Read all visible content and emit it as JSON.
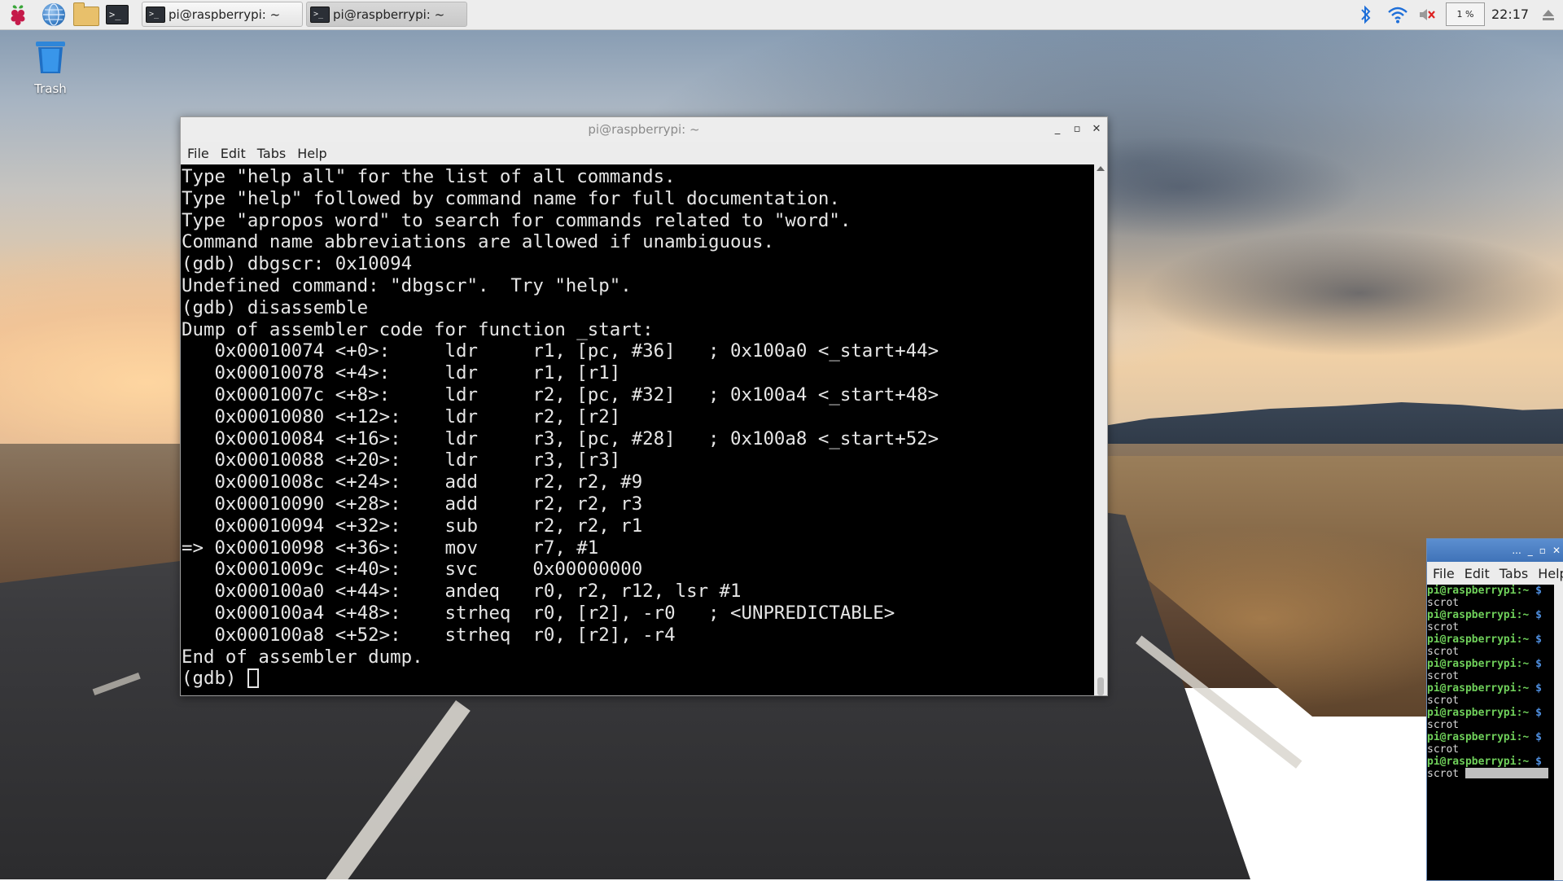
{
  "colors": {
    "panel_bg": "#ededed",
    "terminal_bg": "#000000",
    "terminal_fg": "#e6e6e6",
    "prompt_green": "#6fd05a",
    "prompt_blue": "#4f8fe0",
    "active_title_bg": "#3f73b8"
  },
  "panel": {
    "launchers": [
      "raspberry-pi-menu",
      "web-browser",
      "file-manager",
      "terminal"
    ],
    "tasks": [
      {
        "label": "pi@raspberrypi: ~",
        "active": true
      },
      {
        "label": "pi@raspberrypi: ~",
        "active": false
      }
    ],
    "tray": {
      "icons": [
        "bluetooth-icon",
        "wifi-icon",
        "volume-muted-icon"
      ],
      "cpu": "1 %",
      "clock": "22:17"
    }
  },
  "desktop": {
    "icons": [
      {
        "label": "Trash"
      }
    ]
  },
  "main_window": {
    "title": "pi@raspberrypi: ~",
    "menu": [
      "File",
      "Edit",
      "Tabs",
      "Help"
    ],
    "terminal_lines": [
      "Type \"help all\" for the list of all commands.",
      "Type \"help\" followed by command name for full documentation.",
      "Type \"apropos word\" to search for commands related to \"word\".",
      "Command name abbreviations are allowed if unambiguous.",
      "(gdb) dbgscr: 0x10094",
      "Undefined command: \"dbgscr\".  Try \"help\".",
      "(gdb) disassemble",
      "Dump of assembler code for function _start:",
      "   0x00010074 <+0>:     ldr     r1, [pc, #36]   ; 0x100a0 <_start+44>",
      "   0x00010078 <+4>:     ldr     r1, [r1]",
      "   0x0001007c <+8>:     ldr     r2, [pc, #32]   ; 0x100a4 <_start+48>",
      "   0x00010080 <+12>:    ldr     r2, [r2]",
      "   0x00010084 <+16>:    ldr     r3, [pc, #28]   ; 0x100a8 <_start+52>",
      "   0x00010088 <+20>:    ldr     r3, [r3]",
      "   0x0001008c <+24>:    add     r2, r2, #9",
      "   0x00010090 <+28>:    add     r2, r2, r3",
      "   0x00010094 <+32>:    sub     r2, r2, r1",
      "=> 0x00010098 <+36>:    mov     r7, #1",
      "   0x0001009c <+40>:    svc     0x00000000",
      "   0x000100a0 <+44>:    andeq   r0, r2, r12, lsr #1",
      "   0x000100a4 <+48>:    strheq  r0, [r2], -r0   ; <UNPREDICTABLE>",
      "   0x000100a8 <+52>:    strheq  r0, [r2], -r4",
      "End of assembler dump."
    ],
    "prompt": "(gdb) "
  },
  "side_window": {
    "title": "...",
    "menu": [
      "File",
      "Edit",
      "Tabs",
      "Help"
    ],
    "prompt_user": "pi@raspberrypi:~ ",
    "prompt_symbol": "$",
    "entries": [
      "scrot",
      "scrot",
      "scrot",
      "scrot",
      "scrot",
      "scrot",
      "scrot",
      "scrot"
    ]
  }
}
